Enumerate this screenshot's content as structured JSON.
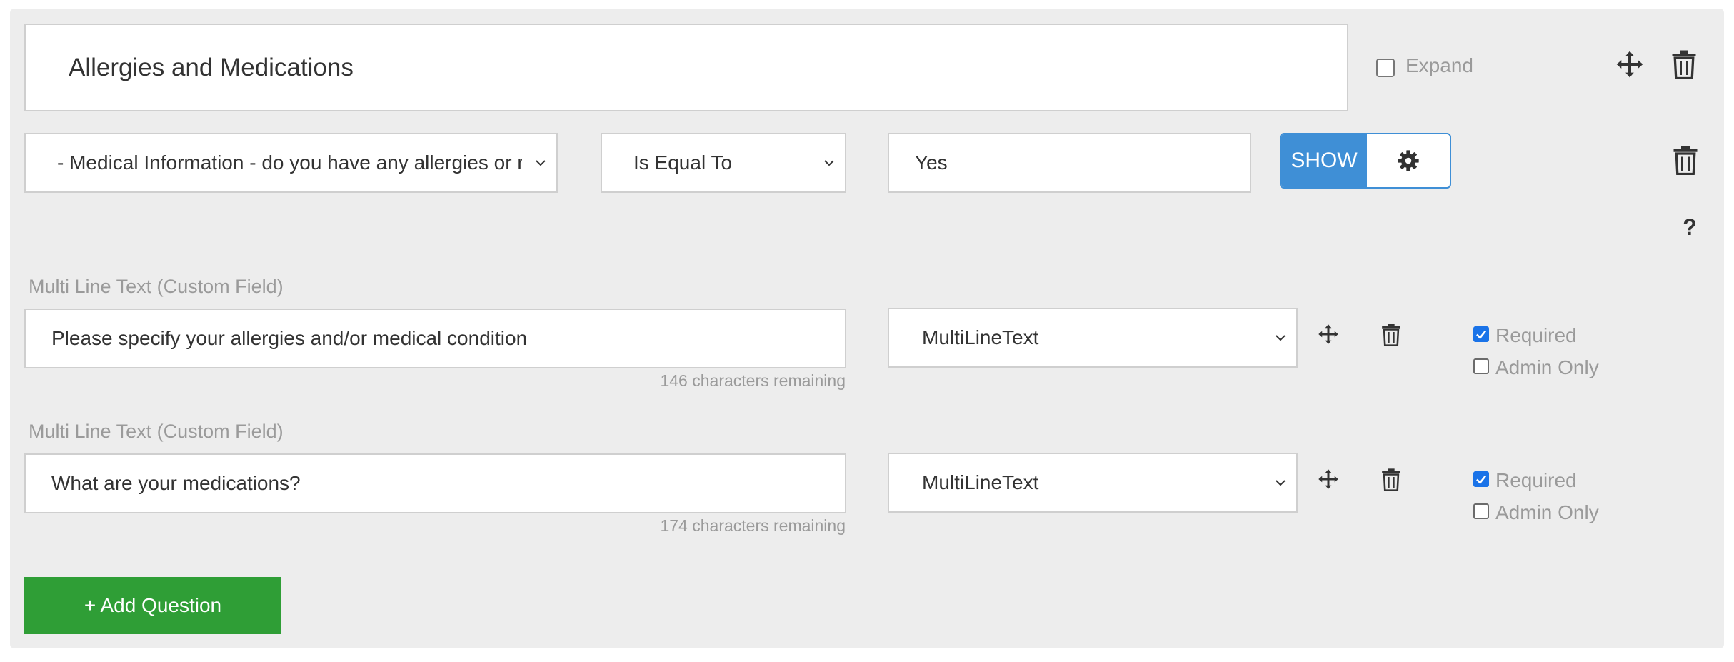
{
  "section": {
    "title": "Allergies and Medications",
    "expand_label": "Expand",
    "expand_checked": false
  },
  "condition": {
    "field_value": "- Medical Information - do you have any allergies or medical conditions?",
    "operator_value": "Is Equal To",
    "value": "Yes",
    "show_label": "SHOW",
    "help_label": "?"
  },
  "questions": [
    {
      "type_caption": "Multi Line Text (Custom Field)",
      "text": "Please specify your allergies and/or medical condition",
      "chars_remaining": "146 characters remaining",
      "field_type": "MultiLineText",
      "required_label": "Required",
      "required_checked": true,
      "admin_only_label": "Admin Only",
      "admin_only_checked": false
    },
    {
      "type_caption": "Multi Line Text (Custom Field)",
      "text": "What are your medications?",
      "chars_remaining": "174 characters remaining",
      "field_type": "MultiLineText",
      "required_label": "Required",
      "required_checked": true,
      "admin_only_label": "Admin Only",
      "admin_only_checked": false
    }
  ],
  "add_question_label": "+ Add Question",
  "colors": {
    "panel_bg": "#ededed",
    "show_blue": "#3f8fd6",
    "add_green": "#2f9e36",
    "checkbox_blue": "#1a73e8",
    "muted_text": "#9a9a9a"
  },
  "icons": [
    "move-icon",
    "trash-icon",
    "gear-icon",
    "chevron-down-icon",
    "check-icon"
  ]
}
